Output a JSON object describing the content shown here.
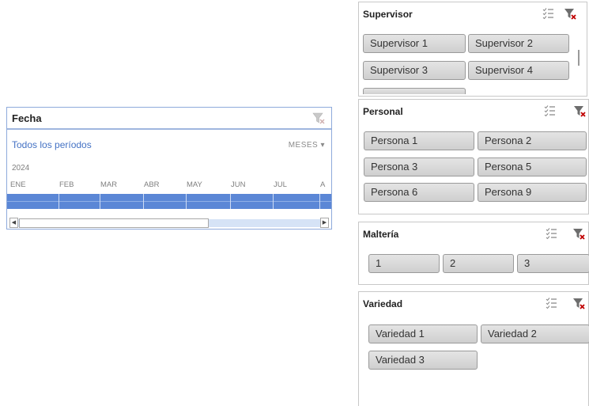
{
  "timeline": {
    "title": "Fecha",
    "all_periods": "Todos los períodos",
    "time_level": "MESES ▾",
    "year": "2024",
    "months": [
      "ENE",
      "FEB",
      "MAR",
      "ABR",
      "MAY",
      "JUN",
      "JUL",
      "A"
    ]
  },
  "supervisor": {
    "title": "Supervisor",
    "items": [
      "Supervisor 1",
      "Supervisor 2",
      "Supervisor 3",
      "Supervisor 4"
    ]
  },
  "personal": {
    "title": "Personal",
    "items": [
      "Persona 1",
      "Persona 2",
      "Persona 3",
      "Persona 5",
      "Persona 6",
      "Persona 9"
    ]
  },
  "malteria": {
    "title": "Maltería",
    "items": [
      "1",
      "2",
      "3"
    ]
  },
  "variedad": {
    "title": "Variedad",
    "items": [
      "Variedad 1",
      "Variedad 2",
      "Variedad 3"
    ]
  },
  "icons": {
    "multi_select": "multi-select-icon",
    "clear_filter": "clear-filter-icon"
  },
  "colors": {
    "timeline_bar": "#5b87d6",
    "timeline_link": "#4472c4",
    "clear_filter_x": "#c00000"
  }
}
